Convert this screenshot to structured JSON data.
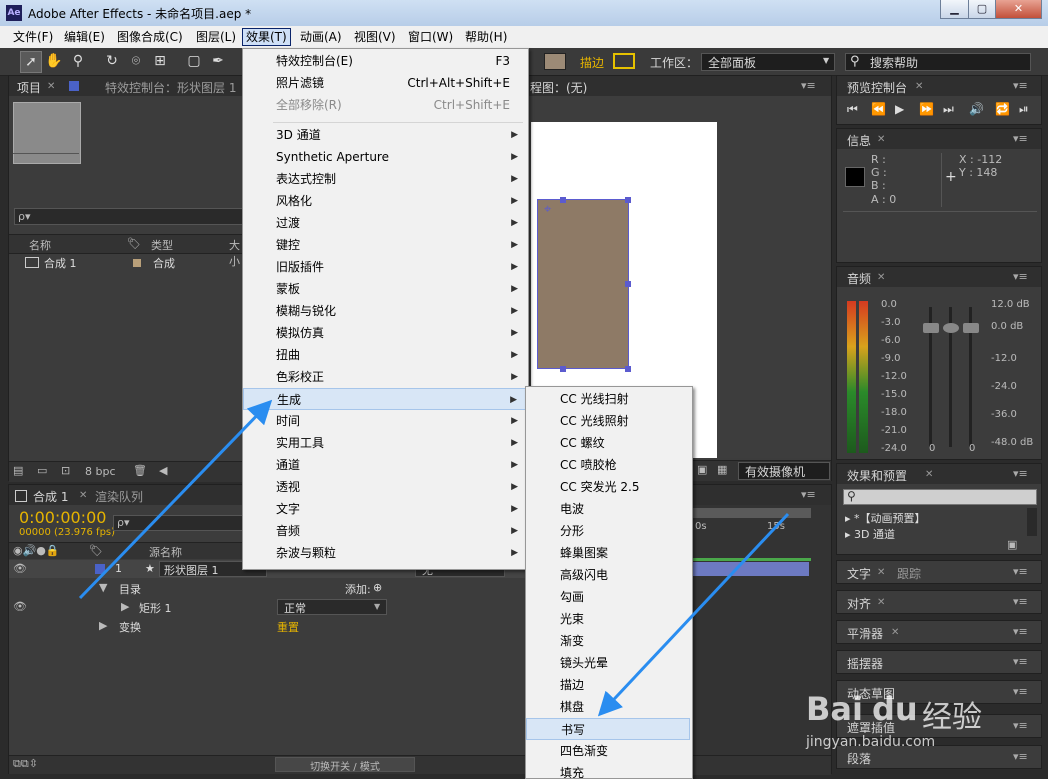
{
  "window": {
    "title": "Adobe After Effects - 未命名项目.aep *",
    "icon": "Ae",
    "min": "▁",
    "max": "▢",
    "close": "✕"
  },
  "menubar": [
    "文件(F)",
    "编辑(E)",
    "图像合成(C)",
    "图层(L)",
    "效果(T)",
    "动画(A)",
    "视图(V)",
    "窗口(W)",
    "帮助(H)"
  ],
  "toolbar": {
    "fill_label": "描边",
    "workspace_label": "工作区：",
    "workspace_value": "全部面板",
    "search_placeholder": "搜索帮助"
  },
  "project_panel": {
    "tab": "项目",
    "effects_tab": "特效控制台：形状图层 1",
    "search": "ρ▾",
    "col_name": "名称",
    "col_type": "类型",
    "col_size": "大小",
    "item_name": "合成 1",
    "item_type": "合成",
    "bpc": "8 bpc"
  },
  "comp_panel": {
    "title_tail": "程图：(无)",
    "camera": "有效摄像机"
  },
  "preview_panel": {
    "tab": "预览控制台"
  },
  "info_panel": {
    "tab": "信息",
    "r": "R :",
    "g": "G :",
    "b": "B :",
    "a": "A : 0",
    "x": "X : -112",
    "y": "Y : 148"
  },
  "audio_panel": {
    "tab": "音频",
    "left_scale": [
      "0.0",
      "-3.0",
      "-6.0",
      "-9.0",
      "-12.0",
      "-15.0",
      "-18.0",
      "-21.0",
      "-24.0"
    ],
    "right_scale": [
      "12.0 dB",
      "0.0 dB",
      "-12.0",
      "-24.0",
      "-36.0",
      "-48.0 dB"
    ],
    "zero1": "0",
    "zero2": "0"
  },
  "effects_presets": {
    "tab": "效果和预置",
    "item1": "▸ *【动画预置】",
    "item2": "▸ 3D 通道"
  },
  "side_tabs": {
    "text": "文字",
    "track": "跟踪",
    "align": "对齐",
    "smoother": "平滑器",
    "wiggler": "摇摆器",
    "motion_sketch": "动态草图",
    "mask_interp": "遮罩插值",
    "paragraph": "段落"
  },
  "timeline": {
    "tab": "合成 1",
    "render_tab": "渲染队列",
    "time": "0:00:00:00",
    "fps": "00000 (23.976 fps)",
    "col_source": "源名称",
    "layer_num": "1",
    "layer_name": "形状图层 1",
    "contents": "目录",
    "add": "添加:",
    "rect": "矩形 1",
    "transform": "变换",
    "mode": "正常",
    "reset": "重置",
    "none": "无",
    "toggle": "切换开关 / 模式",
    "ruler_10": "0s",
    "ruler_15": "15s"
  },
  "effect_menu": {
    "top": [
      {
        "label": "特效控制台(E)",
        "shortcut": "F3",
        "disabled": false
      },
      {
        "label": "照片滤镜",
        "shortcut": "Ctrl+Alt+Shift+E",
        "disabled": false
      },
      {
        "label": "全部移除(R)",
        "shortcut": "Ctrl+Shift+E",
        "disabled": true
      }
    ],
    "items": [
      "3D 通道",
      "Synthetic Aperture",
      "表达式控制",
      "风格化",
      "过渡",
      "键控",
      "旧版插件",
      "蒙板",
      "模糊与锐化",
      "模拟仿真",
      "扭曲",
      "色彩校正",
      "生成",
      "时间",
      "实用工具",
      "通道",
      "透视",
      "文字",
      "音频",
      "杂波与颗粒"
    ],
    "highlighted": "生成"
  },
  "generate_menu": {
    "items": [
      "CC 光线扫射",
      "CC 光线照射",
      "CC 螺纹",
      "CC 喷胶枪",
      "CC 突发光 2.5",
      "电波",
      "分形",
      "蜂巢图案",
      "高级闪电",
      "勾画",
      "光束",
      "渐变",
      "镜头光晕",
      "描边",
      "棋盘",
      "书写",
      "四色渐变",
      "填充"
    ],
    "highlighted": "书写"
  },
  "watermark": {
    "brand": "Bai",
    "paw": "du",
    "cn": "经验",
    "url": "jingyan.baidu.com"
  },
  "colors": {
    "shape_fill": "#8e7a66",
    "accent_blue": "#2a8df0",
    "highlight": "#d8e6f6"
  }
}
